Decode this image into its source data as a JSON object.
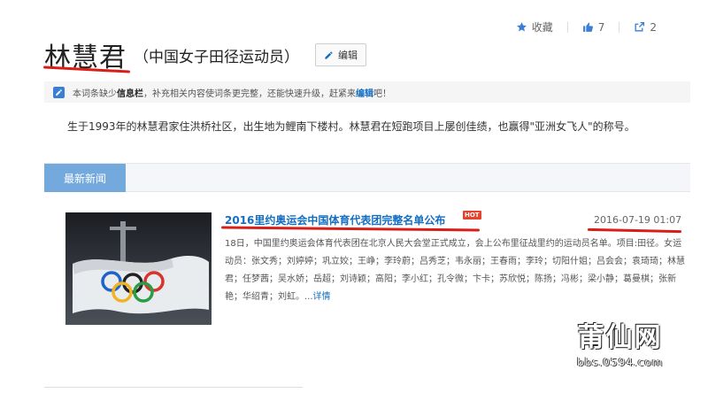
{
  "header": {
    "title": "林慧君",
    "subtitle": "（中国女子田径运动员）",
    "edit_label": "编辑"
  },
  "actions": {
    "favorite_label": "收藏",
    "like_count": "7",
    "share_count": "2"
  },
  "notice": {
    "prefix": "本词条缺少",
    "highlight": "信息栏",
    "middle": "，补充相关内容使词条更完整，还能快速升级，赶紧来",
    "link": "编辑",
    "suffix": "吧！"
  },
  "intro": "生于1993年的林慧君家住洪桥社区，出生地为鲤南下楼村。林慧君在短跑项目上屡创佳绩，也赢得\"亚洲女飞人\"的称号。",
  "news": {
    "tab_label": "最新新闻",
    "item": {
      "title": "2016里约奥运会中国体育代表团完整名单公布",
      "badge": "HOT",
      "date": "2016-07-19 01:07",
      "body": "18日，中国里约奥运会体育代表团在北京人民大会堂正式成立，会上公布里征战里约的运动员名单。项目:田径。女运动员：张文秀；刘婷婷；巩立姣；王峥；李玲蔚；吕秀芝；韦永丽；王春雨；李玲；切阳什姐；吕会会；袁琦琦；林慧君；任梦茜；吴水娇；岳超；刘诗颖；高阳；李小红；孔令微；卞卡；苏欣悦；陈扬；冯彬；梁小静；葛曼棋；张新艳；华绍青；刘虹。...",
      "more_label": "详情"
    }
  },
  "watermark": {
    "line1": "莆仙网",
    "line2": "bbs.0594.com"
  },
  "colors": {
    "link": "#136ec2",
    "tab": "#73a9dd",
    "annotation": "#d91e18"
  }
}
